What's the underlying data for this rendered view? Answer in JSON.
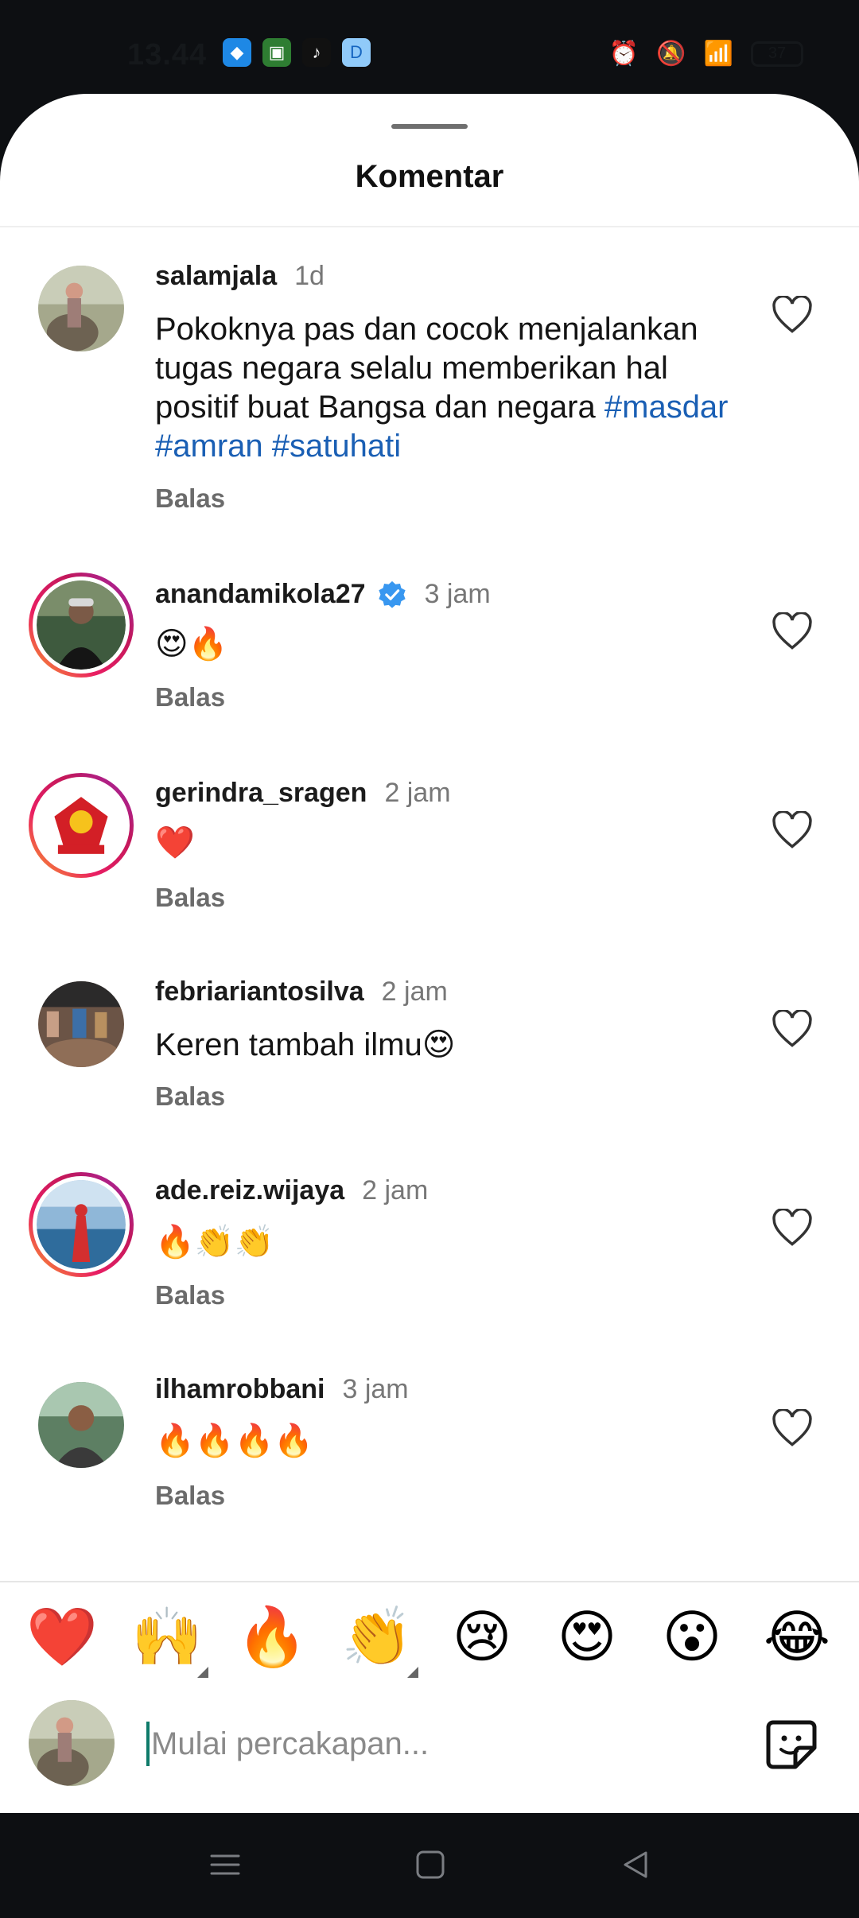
{
  "status_bar": {
    "time": "13.44",
    "battery": "37"
  },
  "sheet": {
    "title": "Komentar"
  },
  "comments": [
    {
      "username": "salamjala",
      "time": "1d",
      "text": "Pokoknya pas dan cocok menjalankan tugas negara selalu memberikan hal positif buat Bangsa dan negara",
      "hashtags": "#masdar #amran #satuhati",
      "reply": "Balas",
      "verified": false
    },
    {
      "username": "anandamikola27",
      "time": "3 jam",
      "text": "😍🔥",
      "reply": "Balas",
      "verified": true
    },
    {
      "username": "gerindra_sragen",
      "time": "2 jam",
      "text": "❤️",
      "reply": "Balas",
      "verified": false
    },
    {
      "username": "febriariantosilva",
      "time": "2 jam",
      "text": "Keren tambah ilmu😍",
      "reply": "Balas",
      "verified": false
    },
    {
      "username": "ade.reiz.wijaya",
      "time": "2 jam",
      "text": "🔥👏👏",
      "reply": "Balas",
      "verified": false
    },
    {
      "username": "ilhamrobbani",
      "time": "3 jam",
      "text": "🔥🔥🔥🔥",
      "reply": "Balas",
      "verified": false
    }
  ],
  "quick_emojis": [
    "❤️",
    "🙌",
    "🔥",
    "👏",
    "😢",
    "😍",
    "😮",
    "😂"
  ],
  "composer": {
    "placeholder": "Mulai percakapan..."
  },
  "colors": {
    "hashtag": "#1a5fb4",
    "verified": "#3897f0",
    "caret": "#0e7b6a"
  }
}
